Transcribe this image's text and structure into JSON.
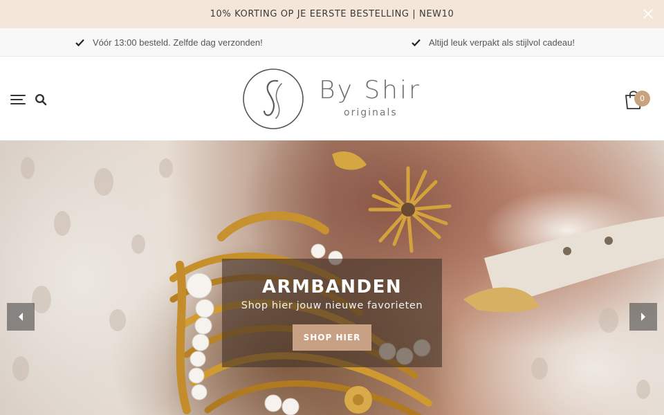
{
  "announcement": {
    "text": "10% KORTING OP JE EERSTE BESTELLING | NEW10",
    "close_icon": "close-icon"
  },
  "usp": {
    "items": [
      {
        "icon": "check-icon",
        "text": "Vóór 13:00 besteld. Zelfde dag verzonden!"
      },
      {
        "icon": "check-icon",
        "text": "Altijd leuk verpakt als stijlvol cadeau!"
      }
    ]
  },
  "header": {
    "menu_icon": "hamburger-menu-icon",
    "search_icon": "search-icon",
    "logo": {
      "name": "By Shir",
      "tagline": "originals"
    },
    "cart": {
      "icon": "shopping-bag-icon",
      "count": "0"
    }
  },
  "hero": {
    "title": "ARMBANDEN",
    "subtitle": "Shop hier jouw nieuwe favorieten",
    "button_label": "SHOP HIER",
    "prev_icon": "arrow-left-icon",
    "next_icon": "arrow-right-icon"
  },
  "colors": {
    "announcement_bg": "#f4e7da",
    "usp_bg": "#f8f8f8",
    "accent": "#c8a47e",
    "button": "#c8a083"
  }
}
